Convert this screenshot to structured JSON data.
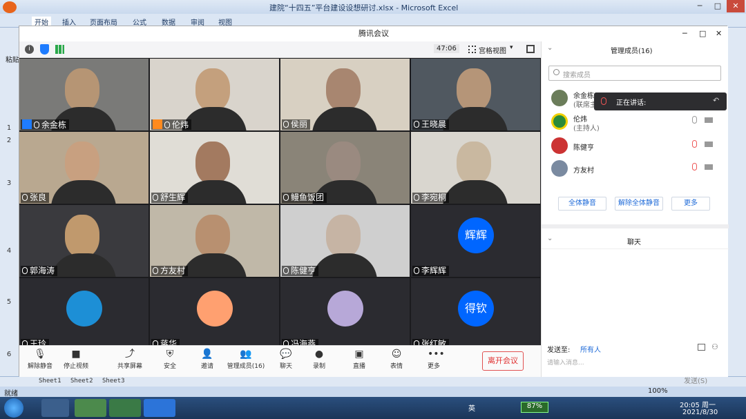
{
  "excel": {
    "title": "建院“十四五”平台建设设想研讨.xlsx - Microsoft Excel",
    "tabs": [
      "开始",
      "插入",
      "页面布局",
      "公式",
      "数据",
      "审阅",
      "视图"
    ],
    "paste_label": "粘贴",
    "rows": [
      "1",
      "2",
      "3",
      "4",
      "5",
      "6"
    ],
    "sheets": [
      "Sheet1",
      "Sheet2",
      "Sheet3"
    ],
    "status_ready": "就绪",
    "zoom": "100%"
  },
  "meeting": {
    "title": "腾讯会议",
    "timer": "47:06",
    "view_mode": "宫格视图",
    "participants": [
      {
        "name": "余金栋",
        "host": "blue"
      },
      {
        "name": "伦炜",
        "host": "orange"
      },
      {
        "name": "侯丽",
        "host": ""
      },
      {
        "name": "王晓晨",
        "host": ""
      },
      {
        "name": "张良",
        "host": ""
      },
      {
        "name": "舒生辉",
        "host": ""
      },
      {
        "name": "鳗鱼饭团",
        "host": ""
      },
      {
        "name": "李宛桐",
        "host": ""
      },
      {
        "name": "郭海涛",
        "host": ""
      },
      {
        "name": "方友村",
        "host": ""
      },
      {
        "name": "陈健亨",
        "host": ""
      },
      {
        "name": "李辉辉",
        "host": ""
      },
      {
        "name": "王玲",
        "host": ""
      },
      {
        "name": "蒋华",
        "host": ""
      },
      {
        "name": "冯海燕",
        "host": ""
      },
      {
        "name": "张红敏",
        "host": ""
      }
    ],
    "avatar_texts": {
      "tile12": "辉辉",
      "tile16": "得钦"
    },
    "controls": [
      "解除静音",
      "停止视频",
      "共享屏幕",
      "安全",
      "邀请",
      "管理成员(16)",
      "聊天",
      "录制",
      "直播",
      "表情",
      "更多"
    ],
    "leave": "离开会议"
  },
  "side": {
    "members_title": "管理成员(16)",
    "search_placeholder": "搜索成员",
    "speaking": "正在讲话:",
    "members": [
      {
        "name": "余金栋",
        "sub": "(联席主"
      },
      {
        "name": "伦炜",
        "sub": "(主持人)"
      },
      {
        "name": "陈健亨",
        "sub": ""
      },
      {
        "name": "方友村",
        "sub": ""
      }
    ],
    "mute_all": "全体静音",
    "unmute_all": "解除全体静音",
    "more": "更多",
    "chat_title": "聊天",
    "send_to_label": "发送至:",
    "send_to_value": "所有人",
    "input_placeholder": "请输入消息...",
    "send_button": "发送(S)"
  },
  "taskbar": {
    "battery": "87%",
    "time": "20:05 周一",
    "date": "2021/8/30",
    "ime": "英"
  }
}
